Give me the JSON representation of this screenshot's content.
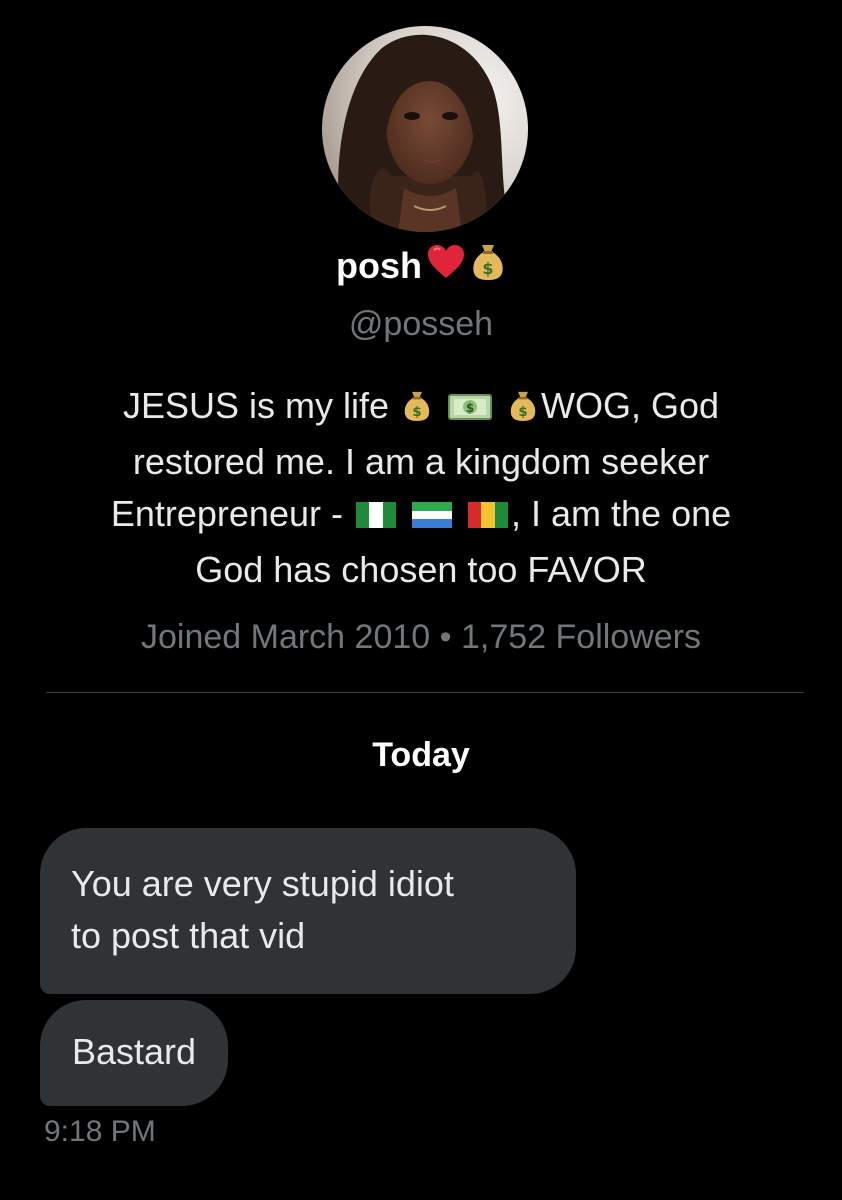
{
  "profile": {
    "display_name": "posh",
    "name_emojis": [
      "red-heart-emoji",
      "money-bag-emoji"
    ],
    "handle": "@posseh",
    "bio_lines": {
      "line1_a": "JESUS is my life",
      "line1_b": "WOG, God",
      "line2": "restored me. I am a kingdom seeker",
      "line3_a": "Entrepreneur -",
      "line3_b": ", I am the one",
      "line4": "God has chosen too FAVOR"
    },
    "joined": "Joined March 2010",
    "separator": "•",
    "followers": "1,752 Followers"
  },
  "conversation": {
    "date_label": "Today",
    "messages": [
      {
        "text_line1": "You are very stupid idiot",
        "text_line2": "to post that vid"
      },
      {
        "text": "Bastard"
      }
    ],
    "timestamp": "9:18 PM"
  },
  "colors": {
    "background": "#000000",
    "bubble": "#2f3336",
    "text_primary": "#e7e9ea",
    "text_secondary": "#71767b",
    "divider": "#3a3d41"
  }
}
